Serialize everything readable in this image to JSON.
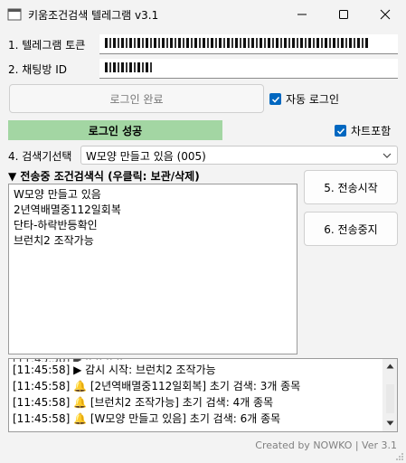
{
  "window": {
    "title": "키움조건검색 텔레그램 v3.1"
  },
  "form": {
    "telegram_token_label": "1. 텔레그램 토큰",
    "chat_id_label": "2. 채팅방 ID",
    "login_button": "로그인 완료",
    "auto_login_label": "자동 로그인",
    "auto_login_checked": true,
    "login_status": "로그인 성공",
    "include_chart_label": "차트포함",
    "include_chart_checked": true,
    "search_select_label": "4. 검색기선택",
    "search_select_value": "W모양 만들고 있음 (005)"
  },
  "conditions": {
    "header": "▼ 전송중 조건검색식 (우클릭: 보관/삭제)",
    "items": [
      "W모양 만들고 있음",
      "2년역배멸중112일회복",
      "단타-하락반등확인",
      "브런치2 조작가능"
    ]
  },
  "actions": {
    "start_button": "5. 전송시작",
    "stop_button": "6. 전송중지"
  },
  "log": {
    "lines": [
      "[11:45:58] ▶ 감시 시작: 브런치2 조작가능",
      "[11:45:58] 🔔 [2년역배멸중112일회복] 초기 검색: 3개 종목",
      "[11:45:58] 🔔 [브런치2 조작가능] 초기 검색: 4개 종목",
      "[11:45:58] 🔔 [W모양 만들고 있음] 초기 검색: 6개 종목"
    ]
  },
  "footer": {
    "credit": "Created by NOWKO | Ver 3.1"
  },
  "colors": {
    "accent": "#0067c0",
    "success": "#a3d6a3"
  }
}
